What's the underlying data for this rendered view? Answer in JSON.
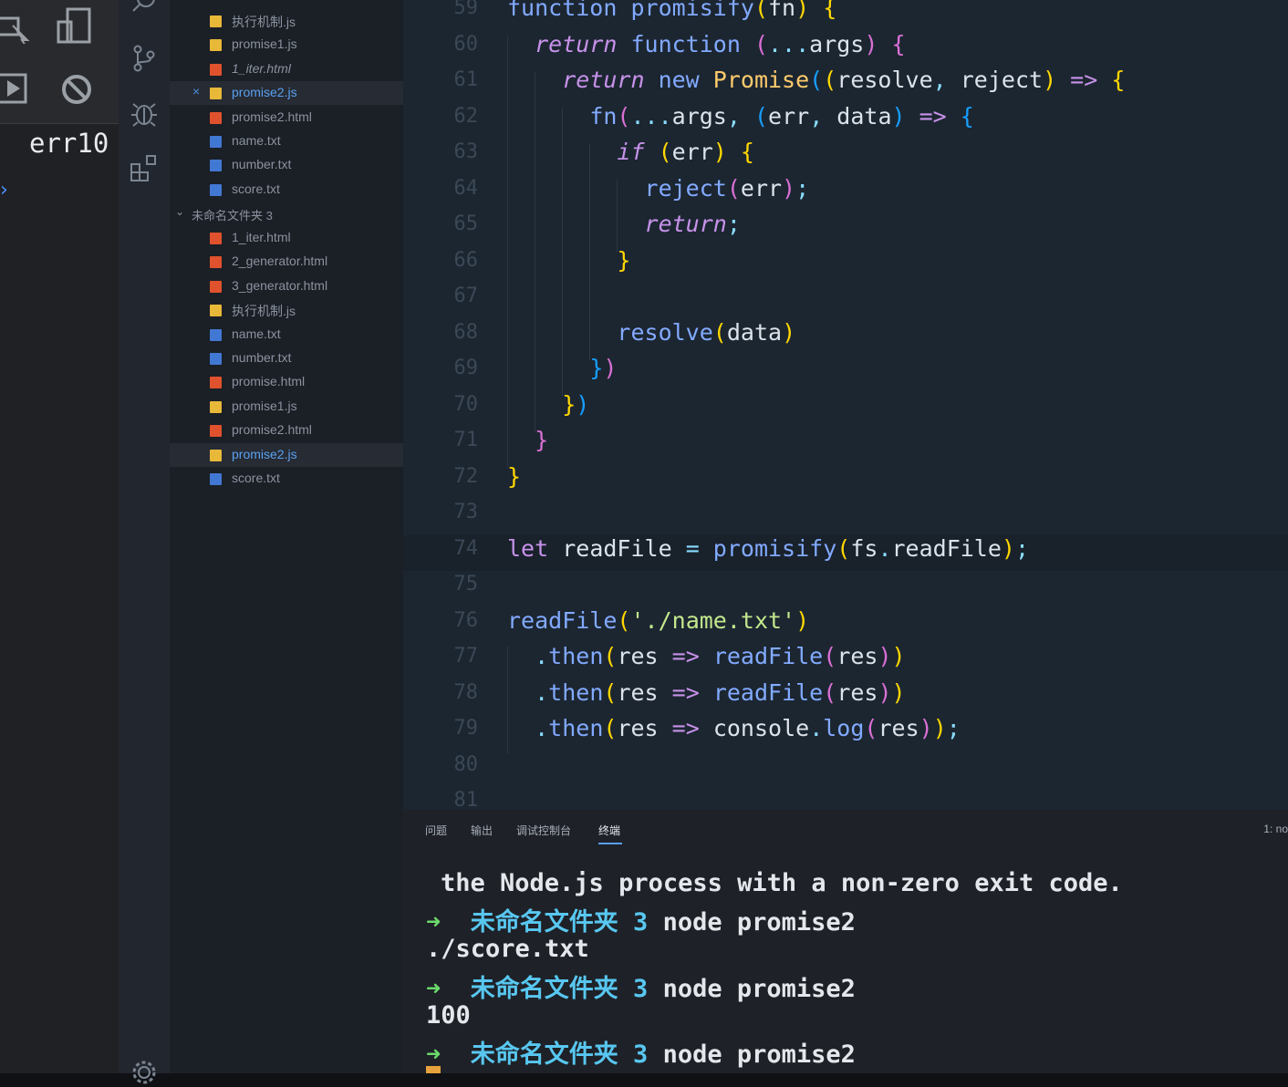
{
  "devtools": {
    "console_text": "err10",
    "prompt_glyph": "›"
  },
  "activity_bar": {
    "icons": [
      "search-icon",
      "source-control-icon",
      "debug-icon",
      "extensions-icon",
      "gear-icon"
    ]
  },
  "explorer": {
    "top_files": [
      {
        "name": "执行机制.js",
        "type": "js"
      },
      {
        "name": "promise1.js",
        "type": "js"
      },
      {
        "name": "1_iter.html",
        "type": "html",
        "italic": true
      },
      {
        "name": "promise2.js",
        "type": "js",
        "active": true,
        "close": "×"
      },
      {
        "name": "promise2.html",
        "type": "html"
      },
      {
        "name": "name.txt",
        "type": "txt"
      },
      {
        "name": "number.txt",
        "type": "txt"
      },
      {
        "name": "score.txt",
        "type": "txt"
      }
    ],
    "folder": {
      "name": "未命名文件夹 3",
      "chevron": "⌄"
    },
    "folder_files": [
      {
        "name": "1_iter.html",
        "type": "html"
      },
      {
        "name": "2_generator.html",
        "type": "html"
      },
      {
        "name": "3_generator.html",
        "type": "html"
      },
      {
        "name": "执行机制.js",
        "type": "js"
      },
      {
        "name": "name.txt",
        "type": "txt"
      },
      {
        "name": "number.txt",
        "type": "txt"
      },
      {
        "name": "promise.html",
        "type": "html"
      },
      {
        "name": "promise1.js",
        "type": "js"
      },
      {
        "name": "promise2.html",
        "type": "html"
      },
      {
        "name": "promise2.js",
        "type": "js",
        "active": true
      },
      {
        "name": "score.txt",
        "type": "txt"
      }
    ]
  },
  "editor": {
    "lines": [
      {
        "n": "59",
        "tokens": [
          [
            "function ",
            "k-blue"
          ],
          [
            "promisify",
            "k-blue"
          ],
          [
            "(",
            "k-gold"
          ],
          [
            "fn",
            "k-white"
          ],
          [
            ")",
            "k-gold"
          ],
          [
            " {",
            "k-gold"
          ]
        ]
      },
      {
        "n": "60",
        "tokens": [
          [
            "  ",
            "k-white"
          ],
          [
            "return",
            "k-italic"
          ],
          [
            " function ",
            "k-blue"
          ],
          [
            "(",
            "k-pink"
          ],
          [
            "...",
            "k-cyan"
          ],
          [
            "args",
            "k-white"
          ],
          [
            ")",
            "k-pink"
          ],
          [
            " {",
            "k-pink"
          ]
        ]
      },
      {
        "n": "61",
        "tokens": [
          [
            "    ",
            "k-white"
          ],
          [
            "return",
            "k-italic"
          ],
          [
            " new ",
            "k-blue"
          ],
          [
            "Promise",
            "k-yellow"
          ],
          [
            "(",
            "k-sky"
          ],
          [
            "(",
            "k-gold"
          ],
          [
            "resolve",
            "k-white"
          ],
          [
            ", ",
            "k-cyan"
          ],
          [
            "reject",
            "k-white"
          ],
          [
            ")",
            "k-gold"
          ],
          [
            " => ",
            "k-purple"
          ],
          [
            "{",
            "k-gold"
          ]
        ]
      },
      {
        "n": "62",
        "tokens": [
          [
            "      ",
            "k-white"
          ],
          [
            "fn",
            "k-blue"
          ],
          [
            "(",
            "k-pink"
          ],
          [
            "...",
            "k-cyan"
          ],
          [
            "args",
            "k-white"
          ],
          [
            ", ",
            "k-cyan"
          ],
          [
            "(",
            "k-sky"
          ],
          [
            "err",
            "k-white"
          ],
          [
            ", ",
            "k-cyan"
          ],
          [
            "data",
            "k-white"
          ],
          [
            ")",
            "k-sky"
          ],
          [
            " => ",
            "k-purple"
          ],
          [
            "{",
            "k-sky"
          ]
        ]
      },
      {
        "n": "63",
        "tokens": [
          [
            "        ",
            "k-white"
          ],
          [
            "if",
            "k-italic"
          ],
          [
            " (",
            "k-gold"
          ],
          [
            "err",
            "k-white"
          ],
          [
            ")",
            "k-gold"
          ],
          [
            " {",
            "k-gold"
          ]
        ]
      },
      {
        "n": "64",
        "tokens": [
          [
            "          ",
            "k-white"
          ],
          [
            "reject",
            "k-blue"
          ],
          [
            "(",
            "k-pink"
          ],
          [
            "err",
            "k-white"
          ],
          [
            ")",
            "k-pink"
          ],
          [
            ";",
            "k-cyan"
          ]
        ]
      },
      {
        "n": "65",
        "tokens": [
          [
            "          ",
            "k-white"
          ],
          [
            "return",
            "k-italic"
          ],
          [
            ";",
            "k-cyan"
          ]
        ]
      },
      {
        "n": "66",
        "tokens": [
          [
            "        ",
            "k-white"
          ],
          [
            "}",
            "k-gold"
          ]
        ]
      },
      {
        "n": "67",
        "tokens": []
      },
      {
        "n": "68",
        "tokens": [
          [
            "        ",
            "k-white"
          ],
          [
            "resolve",
            "k-blue"
          ],
          [
            "(",
            "k-gold"
          ],
          [
            "data",
            "k-white"
          ],
          [
            ")",
            "k-gold"
          ]
        ]
      },
      {
        "n": "69",
        "tokens": [
          [
            "      ",
            "k-white"
          ],
          [
            "}",
            "k-sky"
          ],
          [
            ")",
            "k-pink"
          ]
        ]
      },
      {
        "n": "70",
        "tokens": [
          [
            "    ",
            "k-white"
          ],
          [
            "}",
            "k-gold"
          ],
          [
            ")",
            "k-sky"
          ]
        ]
      },
      {
        "n": "71",
        "tokens": [
          [
            "  ",
            "k-white"
          ],
          [
            "}",
            "k-pink"
          ]
        ]
      },
      {
        "n": "72",
        "tokens": [
          [
            "}",
            "k-gold"
          ]
        ]
      },
      {
        "n": "73",
        "tokens": []
      },
      {
        "n": "74",
        "highlight": true,
        "tokens": [
          [
            "let ",
            "k-purple"
          ],
          [
            "readFile ",
            "k-white"
          ],
          [
            "= ",
            "k-cyan"
          ],
          [
            "promisify",
            "k-blue"
          ],
          [
            "(",
            "k-gold"
          ],
          [
            "fs",
            "k-white"
          ],
          [
            ".",
            "k-cyan"
          ],
          [
            "readFile",
            "k-white"
          ],
          [
            ")",
            "k-gold"
          ],
          [
            ";",
            "k-cyan"
          ]
        ]
      },
      {
        "n": "75",
        "tokens": []
      },
      {
        "n": "76",
        "tokens": [
          [
            "readFile",
            "k-blue"
          ],
          [
            "(",
            "k-gold"
          ],
          [
            "'./name.txt'",
            "k-str"
          ],
          [
            ")",
            "k-gold"
          ]
        ]
      },
      {
        "n": "77",
        "tokens": [
          [
            "  ",
            "k-white"
          ],
          [
            ".",
            "k-cyan"
          ],
          [
            "then",
            "k-blue"
          ],
          [
            "(",
            "k-gold"
          ],
          [
            "res ",
            "k-white"
          ],
          [
            "=> ",
            "k-purple"
          ],
          [
            "readFile",
            "k-blue"
          ],
          [
            "(",
            "k-pink"
          ],
          [
            "res",
            "k-white"
          ],
          [
            ")",
            "k-pink"
          ],
          [
            ")",
            "k-gold"
          ]
        ]
      },
      {
        "n": "78",
        "tokens": [
          [
            "  ",
            "k-white"
          ],
          [
            ".",
            "k-cyan"
          ],
          [
            "then",
            "k-blue"
          ],
          [
            "(",
            "k-gold"
          ],
          [
            "res ",
            "k-white"
          ],
          [
            "=> ",
            "k-purple"
          ],
          [
            "readFile",
            "k-blue"
          ],
          [
            "(",
            "k-pink"
          ],
          [
            "res",
            "k-white"
          ],
          [
            ")",
            "k-pink"
          ],
          [
            ")",
            "k-gold"
          ]
        ]
      },
      {
        "n": "79",
        "tokens": [
          [
            "  ",
            "k-white"
          ],
          [
            ".",
            "k-cyan"
          ],
          [
            "then",
            "k-blue"
          ],
          [
            "(",
            "k-gold"
          ],
          [
            "res ",
            "k-white"
          ],
          [
            "=> ",
            "k-purple"
          ],
          [
            "console",
            "k-white"
          ],
          [
            ".",
            "k-cyan"
          ],
          [
            "log",
            "k-blue"
          ],
          [
            "(",
            "k-pink"
          ],
          [
            "res",
            "k-white"
          ],
          [
            ")",
            "k-pink"
          ],
          [
            ")",
            "k-gold"
          ],
          [
            ";",
            "k-cyan"
          ]
        ]
      },
      {
        "n": "80",
        "tokens": []
      },
      {
        "n": "81",
        "tokens": []
      }
    ]
  },
  "panel": {
    "tabs": [
      {
        "label": "问题"
      },
      {
        "label": "输出"
      },
      {
        "label": "调试控制台"
      },
      {
        "label": "终端",
        "active": true
      }
    ],
    "terminal_selector": "1: no",
    "terminal": {
      "line1": "the Node.js process with a non-zero exit code.",
      "prompt_arrow": "➜",
      "dir": "未命名文件夹 3",
      "command": "node promise2",
      "output1": "./score.txt",
      "output2": "100"
    }
  }
}
